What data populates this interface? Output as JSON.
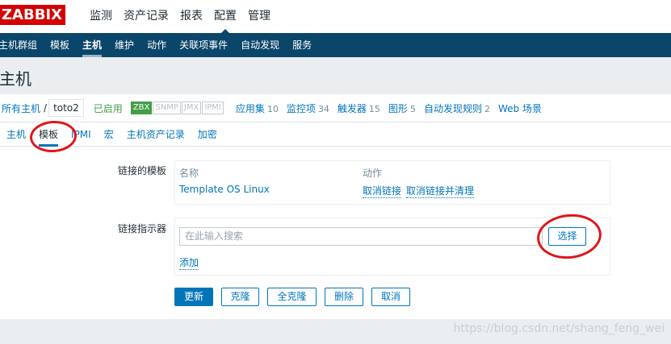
{
  "header": {
    "logo": "ZABBIX",
    "menu": [
      "监测",
      "资产记录",
      "报表",
      "配置",
      "管理"
    ],
    "active_menu": "配置"
  },
  "subnav": {
    "items": [
      "主机群组",
      "模板",
      "主机",
      "维护",
      "动作",
      "关联项事件",
      "自动发现",
      "服务"
    ],
    "active": "主机"
  },
  "page": {
    "title": "主机"
  },
  "breadcrumb": {
    "all_hosts": "所有主机",
    "separator": "/",
    "current_host": "toto2",
    "status": "已启用",
    "availability": [
      "ZBX",
      "SNMP",
      "JMX",
      "IPMI"
    ],
    "links": [
      {
        "label": "应用集",
        "count": "10"
      },
      {
        "label": "监控项",
        "count": "34"
      },
      {
        "label": "触发器",
        "count": "15"
      },
      {
        "label": "图形",
        "count": "5"
      },
      {
        "label": "自动发现规则",
        "count": "2"
      },
      {
        "label": "Web 场景",
        "count": ""
      }
    ]
  },
  "tabs": {
    "items": [
      "主机",
      "模板",
      "IPMI",
      "宏",
      "主机资产记录",
      "加密"
    ],
    "active": "模板"
  },
  "form": {
    "linked_templates_label": "链接的模板",
    "col_name": "名称",
    "col_action": "动作",
    "template_name": "Template OS Linux",
    "unlink": "取消链接",
    "unlink_clear": "取消链接并清理",
    "link_new_label": "链接指示器",
    "search_placeholder": "在此输入搜索",
    "select_button": "选择",
    "add_link": "添加"
  },
  "buttons": {
    "update": "更新",
    "clone": "克隆",
    "full_clone": "全克隆",
    "delete": "删除",
    "cancel": "取消"
  },
  "watermark": "https://blog.csdn.net/shang_feng_wei",
  "colors": {
    "brand_red": "#d40000",
    "nav_blue": "#0a466a",
    "link_blue": "#0275b8",
    "enabled_green": "#429e47",
    "annotation_red": "#e0151b"
  }
}
